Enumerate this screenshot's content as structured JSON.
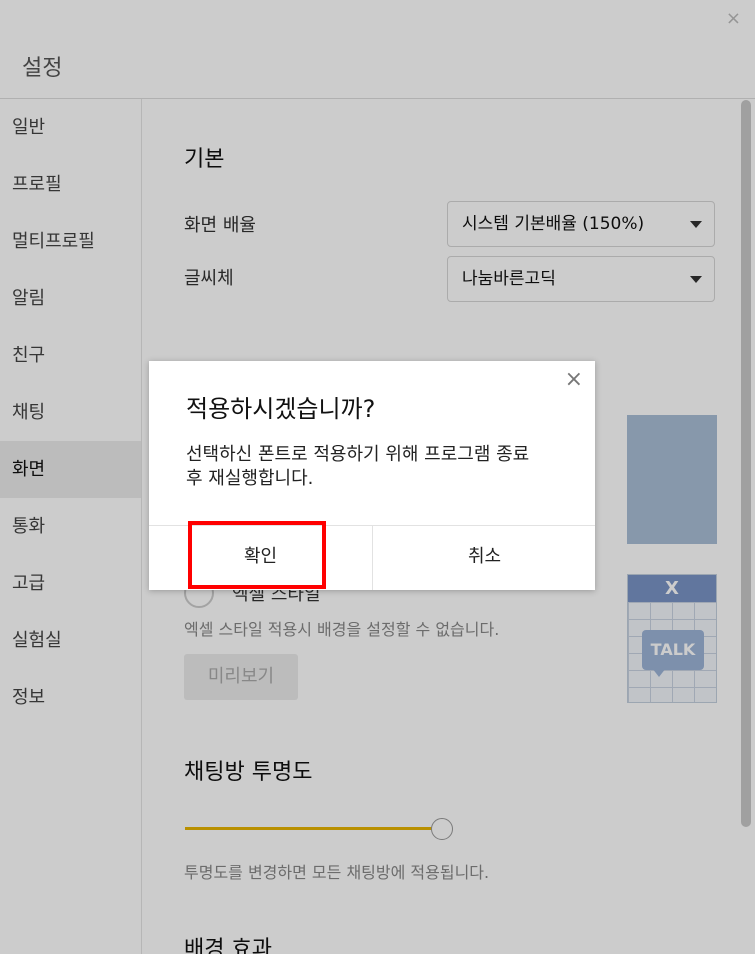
{
  "window": {
    "title": "설정",
    "close_icon": "×"
  },
  "sidebar": {
    "items": [
      {
        "label": "일반"
      },
      {
        "label": "프로필"
      },
      {
        "label": "멀티프로필"
      },
      {
        "label": "알림"
      },
      {
        "label": "친구"
      },
      {
        "label": "채팅"
      },
      {
        "label": "화면",
        "active": true
      },
      {
        "label": "통화"
      },
      {
        "label": "고급"
      },
      {
        "label": "실험실"
      },
      {
        "label": "정보"
      }
    ]
  },
  "content": {
    "basic_title": "기본",
    "screen_scale_label": "화면 배율",
    "screen_scale_value": "시스템 기본배율 (150%)",
    "font_label": "글씨체",
    "font_value": "나눔바른고딕",
    "style_radio_label": "엑셀 스타일",
    "style_hint": "엑셀 스타일 적용시 배경을 설정할 수 없습니다.",
    "preview_button": "미리보기",
    "excel_preview_logo": "X",
    "excel_preview_talk": "TALK",
    "opacity_title": "채팅방 투명도",
    "opacity_hint": "투명도를 변경하면 모든 채팅방에 적용됩니다.",
    "background_effect_title": "배경 효과"
  },
  "dialog": {
    "title": "적용하시겠습니까?",
    "message": "선택하신 폰트로 적용하기 위해 프로그램 종료\n후 재실행합니다.",
    "confirm_label": "확인",
    "cancel_label": "취소",
    "close_icon": "×"
  },
  "colors": {
    "accent_slider": "#e8b400",
    "highlight": "#ff0000"
  }
}
